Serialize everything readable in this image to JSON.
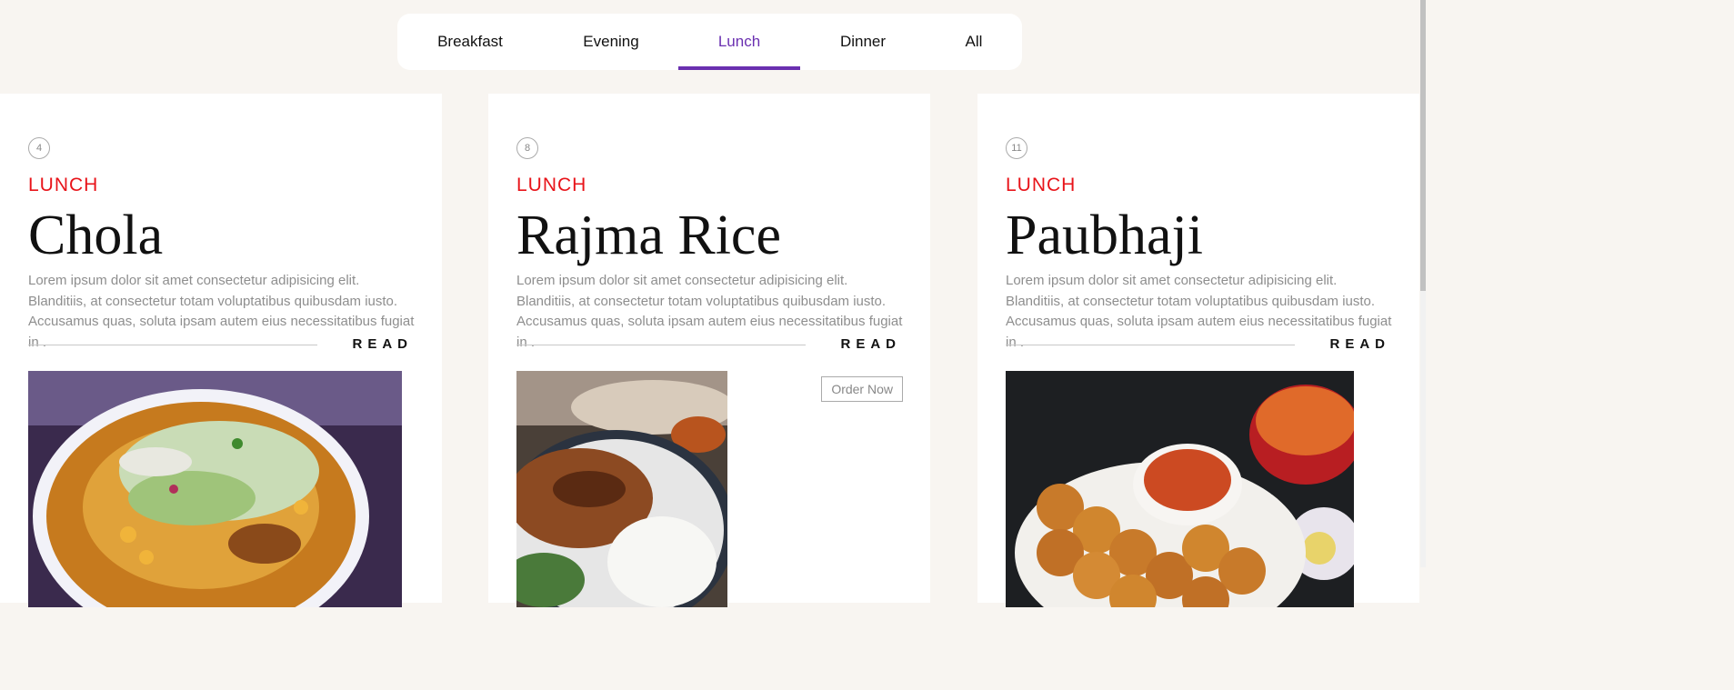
{
  "tabs": [
    {
      "label": "Breakfast",
      "active": false
    },
    {
      "label": "Evening",
      "active": false
    },
    {
      "label": "Lunch",
      "active": true
    },
    {
      "label": "Dinner",
      "active": false
    },
    {
      "label": "All",
      "active": false
    }
  ],
  "colors": {
    "accent": "#6a2fb0",
    "category": "#e8141a",
    "background": "#f8f5f1"
  },
  "cards": [
    {
      "number": "4",
      "category": "LUNCH",
      "title": "Chola",
      "description": "Lorem ipsum dolor sit amet consectetur adipisicing elit. Blanditiis, at consectetur totam voluptatibus quibusdam iusto. Accusamus quas, soluta ipsam autem eius necessitatibus fugiat in .",
      "read_label": "READ",
      "image": "chola-plate-photo"
    },
    {
      "number": "8",
      "category": "LUNCH",
      "title": "Rajma Rice",
      "description": "Lorem ipsum dolor sit amet consectetur adipisicing elit. Blanditiis, at consectetur totam voluptatibus quibusdam iusto. Accusamus quas, soluta ipsam autem eius necessitatibus fugiat in .",
      "read_label": "READ",
      "order_label": "Order Now",
      "image": "rajma-rice-photo"
    },
    {
      "number": "11",
      "category": "LUNCH",
      "title": "Paubhaji",
      "description": "Lorem ipsum dolor sit amet consectetur adipisicing elit. Blanditiis, at consectetur totam voluptatibus quibusdam iusto. Accusamus quas, soluta ipsam autem eius necessitatibus fugiat in .",
      "read_label": "READ",
      "image": "paubhaji-photo"
    }
  ]
}
